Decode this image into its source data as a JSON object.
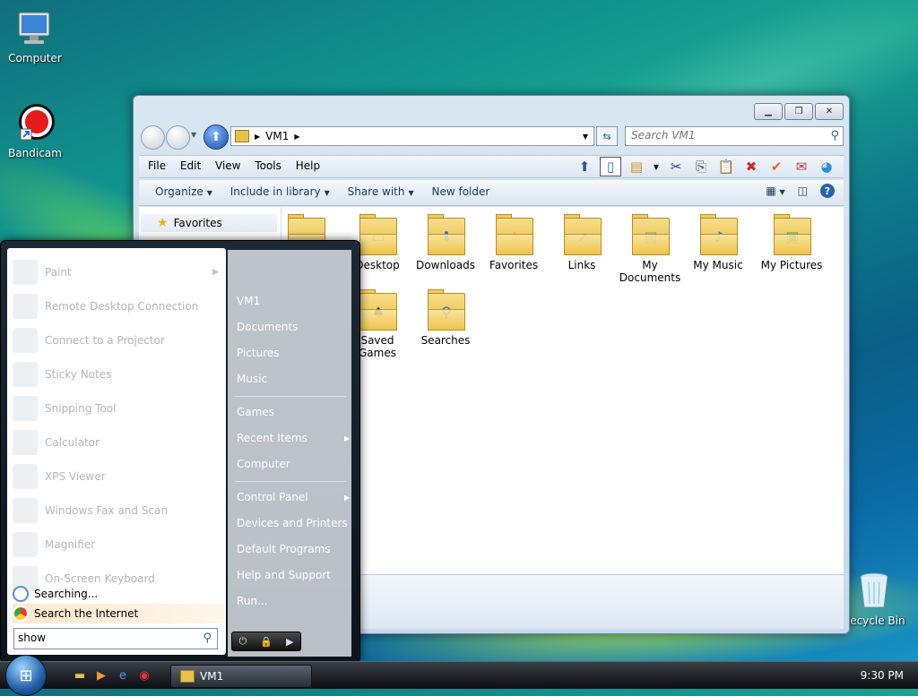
{
  "desktop": {
    "icons": [
      {
        "label": "Computer"
      },
      {
        "label": "Bandicam"
      },
      {
        "label": "Recycle Bin"
      }
    ]
  },
  "explorer": {
    "address": {
      "path": "VM1"
    },
    "search": {
      "placeholder": "Search VM1"
    },
    "menu": [
      "File",
      "Edit",
      "View",
      "Tools",
      "Help"
    ],
    "commands": {
      "organize": "Organize",
      "include": "Include in library",
      "share": "Share with",
      "new_folder": "New folder"
    },
    "navpane": {
      "favorites": "Favorites"
    },
    "folders": [
      {
        "label": "Desktop",
        "icon": "desktop-icon"
      },
      {
        "label": "Downloads",
        "icon": "download-arrow-icon"
      },
      {
        "label": "Favorites",
        "icon": "star-icon"
      },
      {
        "label": "Links",
        "icon": "link-arrow-icon"
      },
      {
        "label": "My Documents",
        "icon": "documents-icon"
      },
      {
        "label": "My Music",
        "icon": "music-note-icon"
      },
      {
        "label": "My Pictures",
        "icon": "picture-icon"
      },
      {
        "label": "Saved Games",
        "icon": "chess-piece-icon"
      },
      {
        "label": "Searches",
        "icon": "magnifier-icon"
      }
    ]
  },
  "startmenu": {
    "programs": [
      {
        "label": "Paint",
        "has_sub": true
      },
      {
        "label": "Remote Desktop Connection"
      },
      {
        "label": "Connect to a Projector"
      },
      {
        "label": "Sticky Notes"
      },
      {
        "label": "Snipping Tool"
      },
      {
        "label": "Calculator"
      },
      {
        "label": "XPS Viewer"
      },
      {
        "label": "Windows Fax and Scan"
      },
      {
        "label": "Magnifier"
      },
      {
        "label": "On-Screen Keyboard"
      }
    ],
    "searching": "Searching...",
    "search_internet": "Search the Internet",
    "search_value": "show",
    "right": [
      {
        "label": "VM1"
      },
      {
        "label": "Documents"
      },
      {
        "label": "Pictures"
      },
      {
        "label": "Music"
      },
      {
        "label": "Games"
      },
      {
        "label": "Recent Items",
        "has_sub": true
      },
      {
        "label": "Computer"
      },
      {
        "label": "Control Panel",
        "has_sub": true
      },
      {
        "label": "Devices and Printers"
      },
      {
        "label": "Default Programs"
      },
      {
        "label": "Help and Support"
      },
      {
        "label": "Run..."
      }
    ]
  },
  "taskbar": {
    "window_button": "VM1",
    "clock": "9:30 PM"
  }
}
